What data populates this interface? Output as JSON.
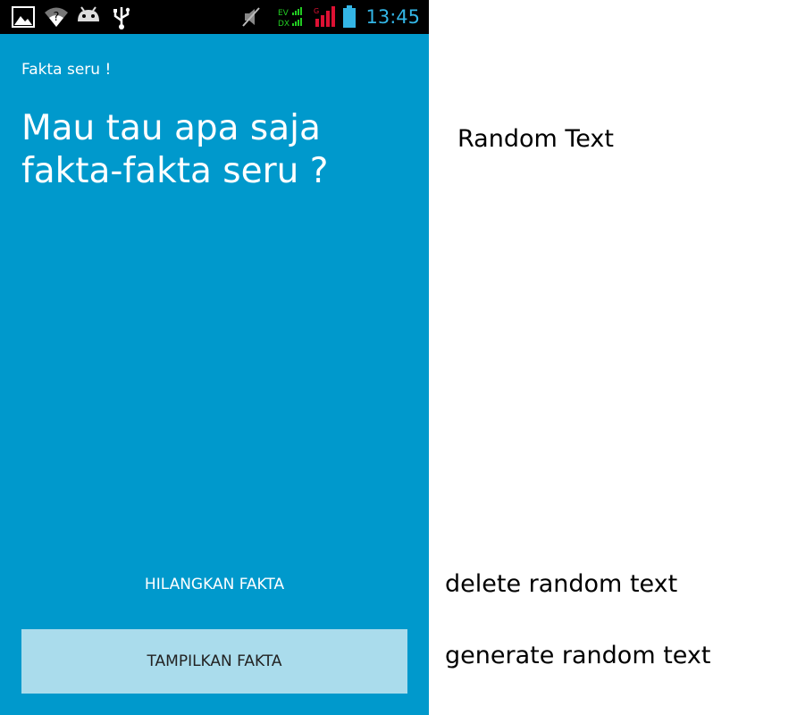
{
  "status_bar": {
    "time": "13:45",
    "icons": [
      "gallery-icon",
      "wifi-icon",
      "android-icon",
      "usb-icon",
      "mute-icon",
      "ev-dx-signal-icon",
      "signal-icon",
      "battery-icon"
    ],
    "signal_labels": [
      "EV",
      "DX"
    ],
    "time_color": "#33b5e5"
  },
  "app": {
    "small_title": "Fakta seru !",
    "headline": "Mau tau apa saja fakta-fakta seru ?",
    "hide_button_label": "HILANGKAN FAKTA",
    "show_button_label": "TAMPILKAN FAKTA",
    "background_color": "#0099cc"
  },
  "annotations": {
    "random_text": "Random Text",
    "delete_text": "delete random text",
    "generate_text": "generate random text"
  }
}
